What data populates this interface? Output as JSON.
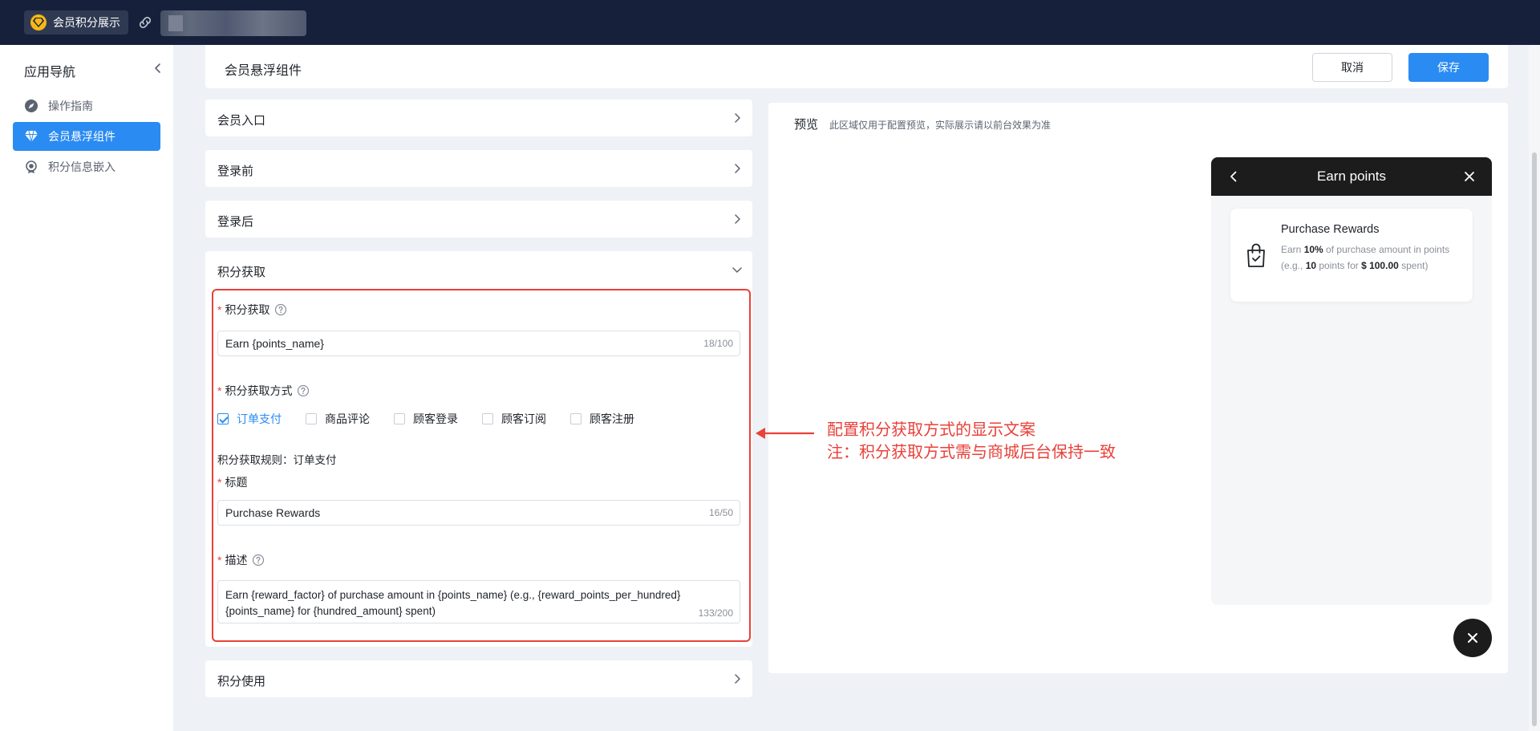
{
  "topbar": {
    "app_name": "会员积分展示"
  },
  "sidebar": {
    "title": "应用导航",
    "items": [
      {
        "label": "操作指南",
        "icon": "navigation-icon",
        "active": false
      },
      {
        "label": "会员悬浮组件",
        "icon": "diamond-icon",
        "active": true
      },
      {
        "label": "积分信息嵌入",
        "icon": "badge-icon",
        "active": false
      }
    ]
  },
  "header": {
    "title": "会员悬浮组件",
    "cancel_label": "取消",
    "save_label": "保存"
  },
  "sections": {
    "member_entry": "会员入口",
    "before_login": "登录前",
    "after_login": "登录后",
    "earn_points": "积分获取",
    "use_points": "积分使用"
  },
  "form": {
    "earn_label": "积分获取",
    "earn_value": "Earn {points_name}",
    "earn_counter": "18/100",
    "method_label": "积分获取方式",
    "methods": [
      {
        "label": "订单支付",
        "checked": true
      },
      {
        "label": "商品评论",
        "checked": false
      },
      {
        "label": "顾客登录",
        "checked": false
      },
      {
        "label": "顾客订阅",
        "checked": false
      },
      {
        "label": "顾客注册",
        "checked": false
      }
    ],
    "rule_text": "积分获取规则：订单支付",
    "title_label": "标题",
    "title_value": "Purchase Rewards",
    "title_counter": "16/50",
    "desc_label": "描述",
    "desc_value": "Earn {reward_factor} of purchase amount in {points_name} (e.g., {reward_points_per_hundred} {points_name} for {hundred_amount} spent)",
    "desc_counter": "133/200"
  },
  "preview": {
    "label": "预览",
    "note": "此区域仅用于配置预览，实际展示请以前台效果为准",
    "widget_title": "Earn points",
    "card_title": "Purchase Rewards",
    "card_desc": {
      "p1": "Earn ",
      "factor": "10%",
      "p2": " of purchase amount in points (e.g., ",
      "points": "10",
      "p3": " points for ",
      "amount": "$ 100.00",
      "p4": " spent)"
    }
  },
  "annotation": {
    "line1": "配置积分获取方式的显示文案",
    "line2": "注：积分获取方式需与商城后台保持一致"
  },
  "colors": {
    "accent": "#2a8bf2",
    "annotation_red": "#e8413a",
    "topbar": "#16203a"
  }
}
